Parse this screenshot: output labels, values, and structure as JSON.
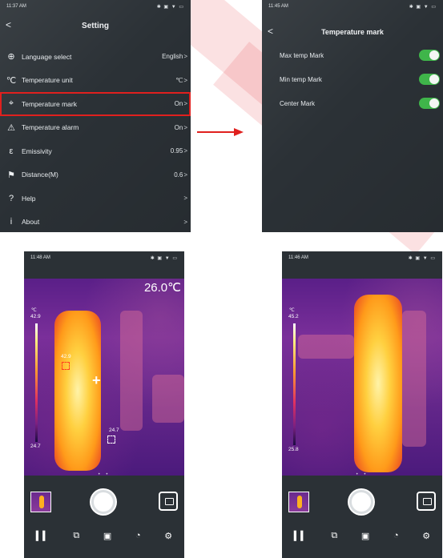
{
  "colors": {
    "accent_red": "#e0201e",
    "toggle_green": "#3fb54a",
    "phone_bg": "#2b3136"
  },
  "settings_screen": {
    "status_time": "11:37 AM",
    "status_icons": "✱ ▣ ▼ ▭",
    "back_glyph": "<",
    "title": "Setting",
    "chevron": ">",
    "items": [
      {
        "icon": "globe-icon",
        "glyph": "⊕",
        "label": "Language select",
        "value": "English",
        "highlighted": false
      },
      {
        "icon": "thermometer-icon",
        "glyph": "℃",
        "label": "Temperature unit",
        "value": "℃",
        "highlighted": false
      },
      {
        "icon": "crosshair-icon",
        "glyph": "⌖",
        "label": "Temperature mark",
        "value": "On",
        "highlighted": true
      },
      {
        "icon": "alarm-icon",
        "glyph": "⚠",
        "label": "Temperature alarm",
        "value": "On",
        "highlighted": false
      },
      {
        "icon": "epsilon-icon",
        "glyph": "ε",
        "label": "Emissivity",
        "value": "0.95",
        "highlighted": false
      },
      {
        "icon": "distance-icon",
        "glyph": "⚑",
        "label": "Distance(M)",
        "value": "0.6",
        "highlighted": false
      },
      {
        "icon": "help-icon",
        "glyph": "?",
        "label": "Help",
        "value": "",
        "highlighted": false
      },
      {
        "icon": "info-icon",
        "glyph": "i",
        "label": "About",
        "value": "",
        "highlighted": false
      }
    ]
  },
  "temperature_mark_screen": {
    "status_time": "11:45 AM",
    "status_icons": "✱ ▣ ▼ ▭",
    "back_glyph": "<",
    "title": "Temperature mark",
    "toggles": [
      {
        "label": "Max temp Mark",
        "on": true
      },
      {
        "label": "Min temp Mark",
        "on": true
      },
      {
        "label": "Center Mark",
        "on": true
      }
    ]
  },
  "camera_screen_1": {
    "status_time": "11:48 AM",
    "status_icons": "✱ ▣ ▼ ▭",
    "center_temp": "26.0℃",
    "unit": "℃",
    "scale_max": "42.9",
    "scale_min": "24.7",
    "max_mark_value": "42.9",
    "min_mark_value": "24.7",
    "page_dots": "• •"
  },
  "camera_screen_2": {
    "status_time": "11:46 AM",
    "status_icons": "✱ ▣ ▼ ▭",
    "unit": "℃",
    "scale_max": "45.2",
    "scale_min": "25.8",
    "page_dots": "• •"
  },
  "camera_toolbar": [
    {
      "icon": "split-view-icon",
      "glyph": "▍▍"
    },
    {
      "icon": "overlay-icon",
      "glyph": "⧉"
    },
    {
      "icon": "palette-frame-icon",
      "glyph": "▣"
    },
    {
      "icon": "color-palette-icon",
      "glyph": "◔"
    },
    {
      "icon": "settings-gear-icon",
      "glyph": "⚙"
    }
  ]
}
